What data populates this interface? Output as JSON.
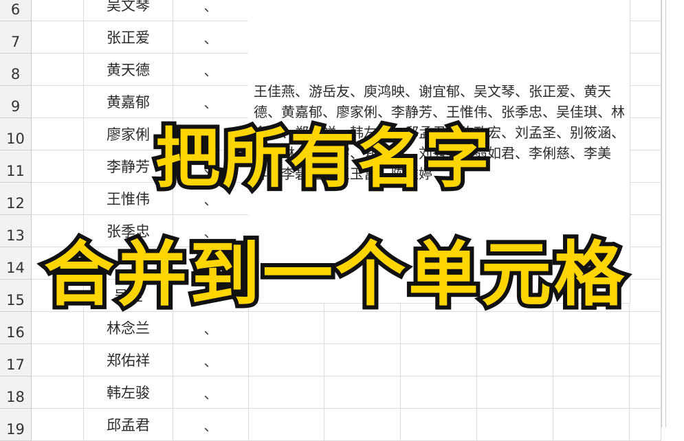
{
  "rows": [
    {
      "num": "6",
      "name": "吴文琴",
      "mark": "、"
    },
    {
      "num": "7",
      "name": "张正爱",
      "mark": "、"
    },
    {
      "num": "8",
      "name": "黄天德",
      "mark": "、"
    },
    {
      "num": "9",
      "name": "黄嘉郁",
      "mark": "、"
    },
    {
      "num": "10",
      "name": "廖家俐",
      "mark": "、"
    },
    {
      "num": "11",
      "name": "李静芳",
      "mark": "、"
    },
    {
      "num": "12",
      "name": "王惟伟",
      "mark": "、"
    },
    {
      "num": "13",
      "name": "张季忠",
      "mark": "、"
    },
    {
      "num": "14",
      "name": "",
      "mark": ""
    },
    {
      "num": "15",
      "name": "吴佳",
      "mark": "、"
    },
    {
      "num": "16",
      "name": "林念兰",
      "mark": "、"
    },
    {
      "num": "17",
      "name": "郑佑祥",
      "mark": "、"
    },
    {
      "num": "18",
      "name": "韩左骏",
      "mark": "、"
    },
    {
      "num": "19",
      "name": "邱孟君",
      "mark": "、"
    }
  ],
  "merged_cell": {
    "text": "王佳燕、游岳友、庾鸿映、谢宜郁、吴文琴、张正爱、黄天德、黄嘉郁、廖家俐、李静芳、王惟伟、张季忠、吴佳琪、林念兰、郑佑祥、韩左骏、邱孟君、陈政宏、刘孟圣、别筱涵、郭雅琳、陈思宇、郑家豪、刘秀英、翁如君、李俐慈、李美昇、李碧宝、王玉富、陈雅婷"
  },
  "overlay": {
    "line1": "把所有名字",
    "line2": "合并到一个单元格"
  }
}
